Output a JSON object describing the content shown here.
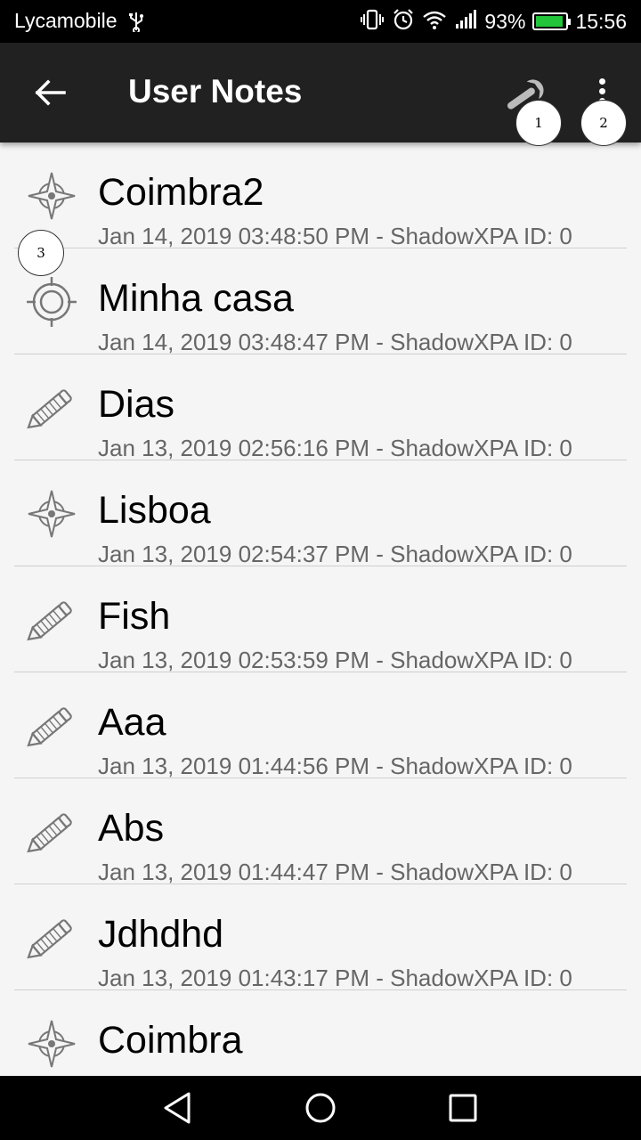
{
  "status_bar": {
    "carrier": "Lycamobile",
    "battery_percent": "93%",
    "time": "15:56",
    "icons": [
      "usb-icon",
      "vibrate-icon",
      "alarm-icon",
      "wifi-icon",
      "signal-icon",
      "battery-icon"
    ]
  },
  "app_bar": {
    "title": "User Notes",
    "icons": [
      "back-arrow-icon",
      "wrench-icon",
      "overflow-menu-icon"
    ]
  },
  "badges": [
    "1",
    "2",
    "3"
  ],
  "notes": [
    {
      "name": "Coimbra2",
      "meta": "Jan 14, 2019 03:48:50 PM - ShadowXPA ID: 0",
      "icon": "compass-rose-icon"
    },
    {
      "name": "Minha casa",
      "meta": "Jan 14, 2019 03:48:47 PM - ShadowXPA ID: 0",
      "icon": "crosshair-target-icon"
    },
    {
      "name": "Dias",
      "meta": "Jan 13, 2019 02:56:16 PM - ShadowXPA ID: 0",
      "icon": "pencil-icon"
    },
    {
      "name": "Lisboa",
      "meta": "Jan 13, 2019 02:54:37 PM - ShadowXPA ID: 0",
      "icon": "compass-rose-icon"
    },
    {
      "name": "Fish",
      "meta": "Jan 13, 2019 02:53:59 PM - ShadowXPA ID: 0",
      "icon": "pencil-icon"
    },
    {
      "name": "Aaa",
      "meta": "Jan 13, 2019 01:44:56 PM - ShadowXPA ID: 0",
      "icon": "pencil-icon"
    },
    {
      "name": "Abs",
      "meta": "Jan 13, 2019 01:44:47 PM - ShadowXPA ID: 0",
      "icon": "pencil-icon"
    },
    {
      "name": "Jdhdhd",
      "meta": "Jan 13, 2019 01:43:17 PM - ShadowXPA ID: 0",
      "icon": "pencil-icon"
    },
    {
      "name": "Coimbra",
      "meta": "",
      "icon": "compass-rose-icon"
    }
  ],
  "nav_bar": {
    "icons": [
      "nav-back-icon",
      "nav-home-icon",
      "nav-recents-icon"
    ]
  },
  "colors": {
    "status_bar_bg": "#000000",
    "app_bar_bg": "#212121",
    "list_bg": "#f5f5f5",
    "battery_fill": "#22c43a"
  }
}
